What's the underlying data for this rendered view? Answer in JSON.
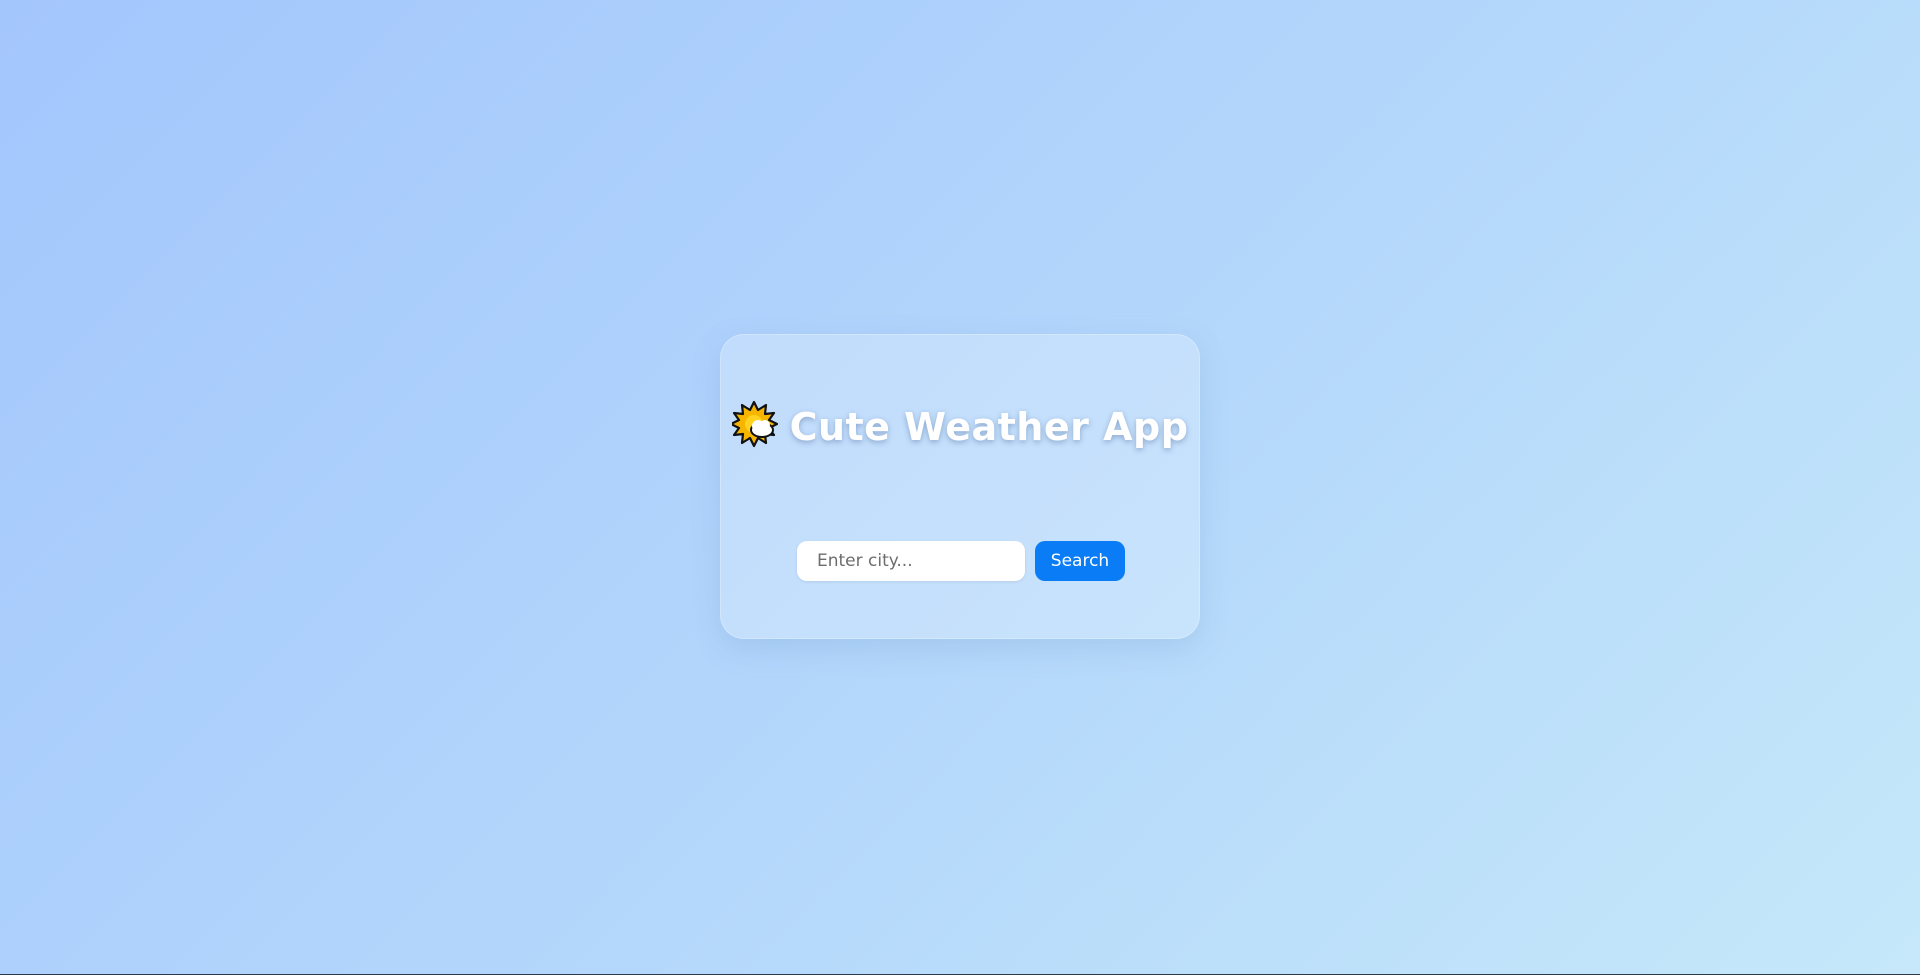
{
  "app": {
    "title": "Cute Weather App",
    "title_icon": "sun-behind-cloud-icon"
  },
  "search": {
    "placeholder": "Enter city...",
    "value": "",
    "button_label": "Search"
  },
  "colors": {
    "background_start": "#a3c6fd",
    "background_end": "#c6e8fa",
    "button": "#0a7cf5",
    "title_text": "#ffffff"
  }
}
